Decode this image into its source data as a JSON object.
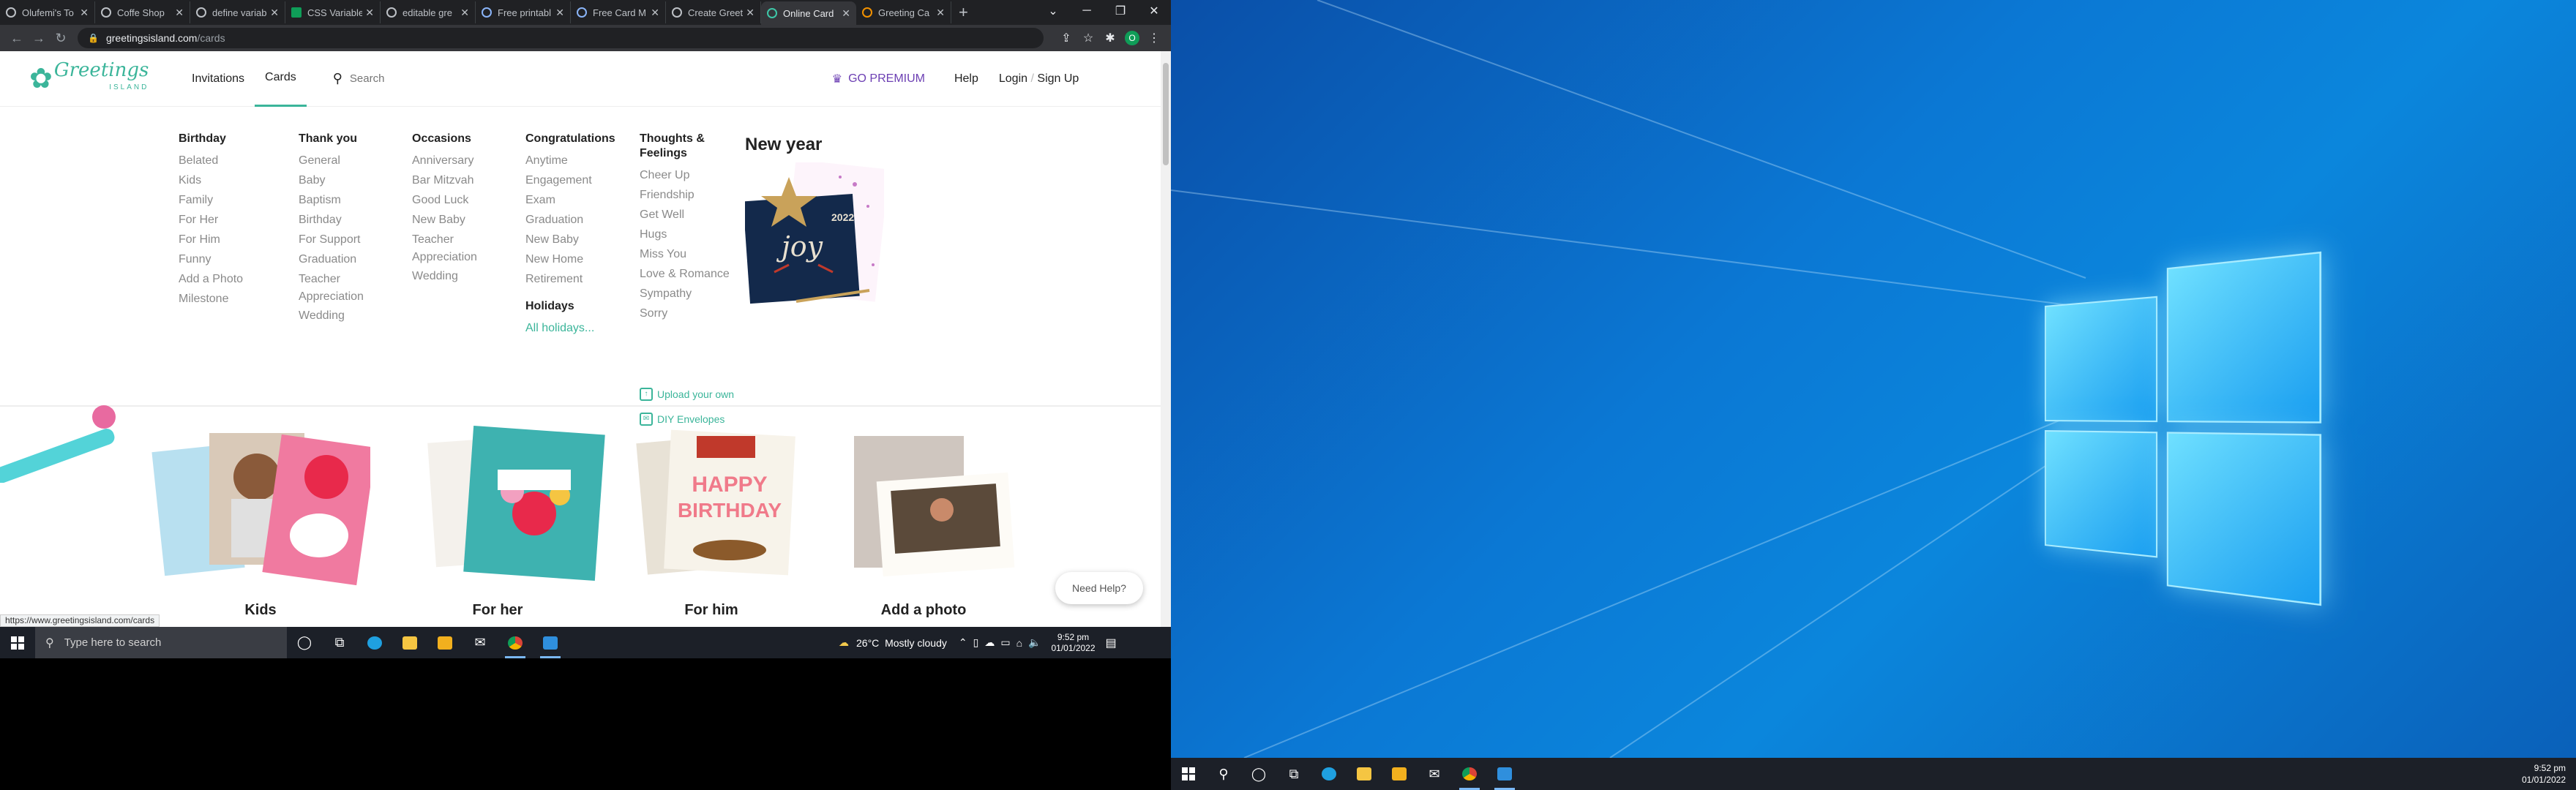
{
  "browser": {
    "tabs": [
      {
        "title": "Olufemi's To",
        "icon": "globe-icon",
        "active": false
      },
      {
        "title": "Coffe Shop",
        "icon": "globe-icon",
        "active": false
      },
      {
        "title": "define variab",
        "icon": "google-icon",
        "active": false
      },
      {
        "title": "CSS Variable",
        "icon": "w3schools-icon",
        "active": false
      },
      {
        "title": "editable gre",
        "icon": "google-icon",
        "active": false
      },
      {
        "title": "Free printabl",
        "icon": "site-icon",
        "active": false
      },
      {
        "title": "Free Card M",
        "icon": "site-icon",
        "active": false
      },
      {
        "title": "Create Greet",
        "icon": "site-icon",
        "active": false
      },
      {
        "title": "Online Card",
        "icon": "greetings-island-icon",
        "active": true
      },
      {
        "title": "Greeting Ca",
        "icon": "etsy-icon",
        "active": false
      }
    ],
    "url_host": "greetingsisland.com",
    "url_path": "/cards",
    "status_url": "https://www.greetingsisland.com/cards",
    "profile_initial": "O"
  },
  "site": {
    "logo_text": "Greetings",
    "logo_sub": "ISLAND",
    "nav": [
      "Invitations",
      "Cards"
    ],
    "search_placeholder": "Search",
    "premium": "GO PREMIUM",
    "help": "Help",
    "login": "Login",
    "signup": "Sign Up"
  },
  "menu": {
    "birthday": {
      "title": "Birthday",
      "items": [
        "Belated",
        "Kids",
        "Family",
        "For Her",
        "For Him",
        "Funny",
        "Add a Photo",
        "Milestone"
      ]
    },
    "thankyou": {
      "title": "Thank you",
      "items": [
        "General",
        "Baby",
        "Baptism",
        "Birthday",
        "For Support",
        "Graduation",
        "Teacher",
        "Appreciation",
        "Wedding"
      ]
    },
    "occasions": {
      "title": "Occasions",
      "items": [
        "Anniversary",
        "Bar Mitzvah",
        "Good Luck",
        "New Baby",
        "Teacher",
        "Appreciation",
        "Wedding"
      ]
    },
    "congrats": {
      "title": "Congratulations",
      "items": [
        "Anytime",
        "Engagement",
        "Exam",
        "Graduation",
        "New Baby",
        "New Home",
        "Retirement"
      ],
      "holidays_title": "Holidays",
      "holidays_link": "All holidays..."
    },
    "thoughts": {
      "title1": "Thoughts &",
      "title2": "Feelings",
      "items": [
        "Cheer Up",
        "Friendship",
        "Get Well",
        "Hugs",
        "Miss You",
        "Love & Romance",
        "Sympathy",
        "Sorry"
      ],
      "upload": "Upload your own",
      "envelopes": "DIY Envelopes"
    },
    "featured": {
      "title": "New year",
      "card_text": "joy",
      "card_year": "2022"
    }
  },
  "products": [
    "Kids",
    "For her",
    "For him",
    "Add a photo"
  ],
  "need_help": "Need Help?",
  "taskbar": {
    "search_placeholder": "Type here to search",
    "weather_temp": "26°C",
    "weather_desc": "Mostly cloudy",
    "time": "9:52 pm",
    "date": "01/01/2022"
  },
  "taskbar2": {
    "time": "9:52 pm",
    "date": "01/01/2022"
  }
}
